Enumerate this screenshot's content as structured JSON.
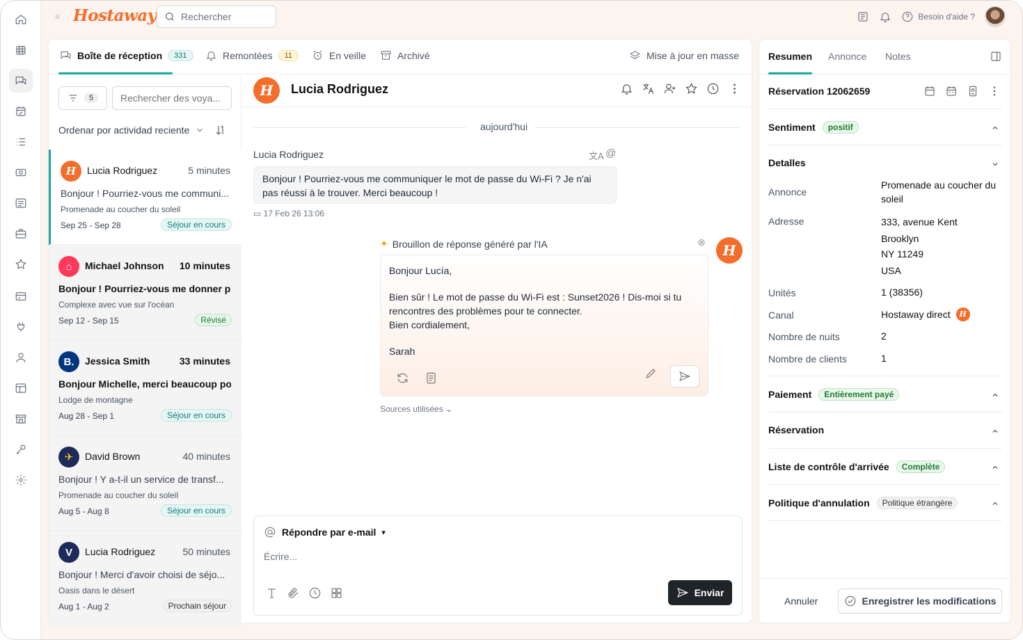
{
  "app": {
    "logo": "Hostaway"
  },
  "topbar": {
    "search_placeholder": "Rechercher",
    "help_label": "Besoin d'aide ?"
  },
  "inbox_tabs": [
    {
      "label": "Boîte de réception",
      "count": "331"
    },
    {
      "label": "Remontées",
      "count": "11"
    },
    {
      "label": "En veille"
    },
    {
      "label": "Archivé"
    }
  ],
  "bulk_update_label": "Mise à jour en masse",
  "list": {
    "filter_count": "5",
    "search_placeholder": "Rechercher des voya...",
    "sort_label": "Ordenar por actividad reciente",
    "conversations": [
      {
        "name": "Lucia Rodriguez",
        "time": "5 minutes",
        "message": "Bonjour ! Pourriez-vous me communi...",
        "property": "Promenade au coucher du soleil",
        "dates": "Sep 25 - Sep 28",
        "status": "Séjour en cours",
        "channel": "hostaway"
      },
      {
        "name": "Michael Johnson",
        "time": "10 minutes",
        "message": "Bonjour ! Pourriez-vous me donner p...",
        "property": "Complexe avec vue sur l'océan",
        "dates": "Sep 12 - Sep 15",
        "status": "Révisé",
        "channel": "airbnb"
      },
      {
        "name": "Jessica Smith",
        "time": "33 minutes",
        "message": "Bonjour Michelle, merci beaucoup po...",
        "property": "Lodge de montagne",
        "dates": "Aug 28 - Sep 1",
        "status": "Séjour en cours",
        "channel": "booking"
      },
      {
        "name": "David Brown",
        "time": "40 minutes",
        "message": "Bonjour ! Y a-t-il un service de transf...",
        "property": "Promenade au coucher du soleil",
        "dates": "Aug 5 - Aug 8",
        "status": "Séjour en cours",
        "channel": "expedia"
      },
      {
        "name": "Lucia Rodriguez",
        "time": "50 minutes",
        "message": "Bonjour ! Merci d'avoir choisi de séjo...",
        "property": "Oasis dans le désert",
        "dates": "Aug 1 - Aug 2",
        "status": "Prochain séjour",
        "channel": "vrbo"
      }
    ]
  },
  "chat": {
    "guest_name": "Lucia Rodriguez",
    "day_label": "aujourd'hui",
    "sender": "Lucia Rodriguez",
    "message": "Bonjour ! Pourriez-vous me communiquer le mot de passe du Wi-Fi ? Je n'ai pas réussi à le trouver. Merci beaucoup !",
    "message_time": "17 Feb 26 13:06",
    "ai_title": "Brouillon de réponse généré par l'IA",
    "ai_greeting": "Bonjour Lucía,",
    "ai_body": "Bien sûr ! Le mot de passe du Wi-Fi est : Sunset2026 ! Dis-moi si tu rencontres des problèmes pour te connecter.",
    "ai_closing": "Bien cordialement,",
    "ai_signature": "Sarah",
    "sources_label": "Sources utilisées",
    "reply_mode": "Répondre par e-mail",
    "compose_placeholder": "Écrire...",
    "send_label": "Enviar"
  },
  "side": {
    "tabs": [
      "Resumen",
      "Annonce",
      "Notes"
    ],
    "reservation_label": "Réservation 12062659",
    "sentiment": {
      "label": "Sentiment",
      "badge": "positif"
    },
    "details": {
      "title": "Detalles",
      "rows": [
        {
          "label": "Annonce",
          "value": "Promenade au coucher du soleil"
        },
        {
          "label": "Adresse",
          "value_lines": [
            "333, avenue Kent",
            "Brooklyn",
            "NY 11249",
            "USA"
          ]
        },
        {
          "label": "Unités",
          "value": "1 (38356)"
        },
        {
          "label": "Canal",
          "value": "Hostaway direct"
        },
        {
          "label": "Nombre de nuits",
          "value": "2"
        },
        {
          "label": "Nombre de clients",
          "value": "1"
        }
      ]
    },
    "payment": {
      "label": "Paiement",
      "badge": "Entièrement payé"
    },
    "reservation_section": "Réservation",
    "checkin": {
      "label": "Liste de contrôle d'arrivée",
      "badge": "Complète"
    },
    "cancellation": {
      "label": "Politique d'annulation",
      "badge": "Politique étrangère"
    },
    "cancel_label": "Annuler",
    "save_label": "Enregistrer les modifications"
  },
  "colors": {
    "accent": "#19a8a0",
    "brand": "#f36d2b",
    "airbnb": "#ff385c",
    "booking": "#003580",
    "expedia": "#1e2a5a"
  }
}
